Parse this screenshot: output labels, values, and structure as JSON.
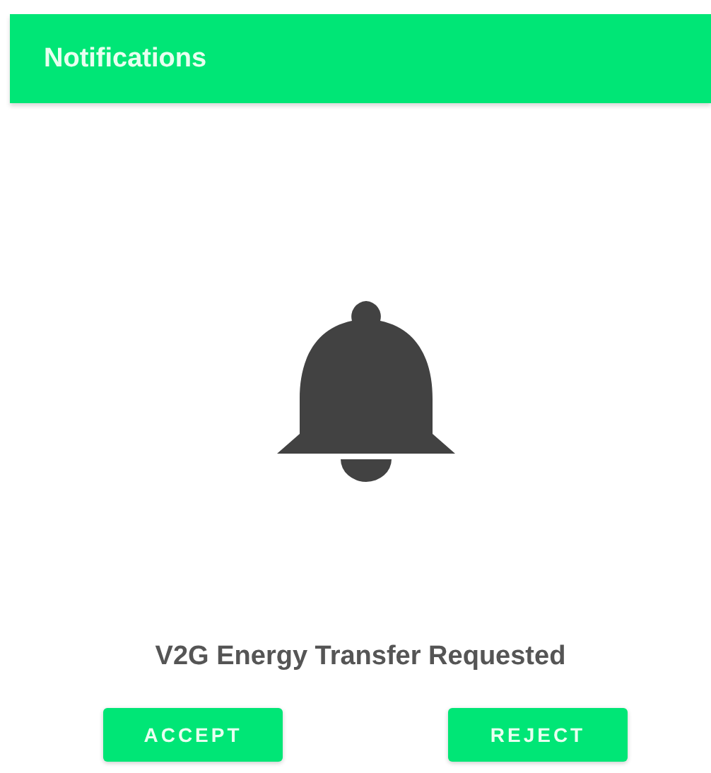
{
  "app_bar": {
    "title": "Notifications"
  },
  "message": "V2G Energy Transfer Requested",
  "buttons": [
    {
      "label": "ACCEPT"
    },
    {
      "label": "REJECT"
    }
  ]
}
